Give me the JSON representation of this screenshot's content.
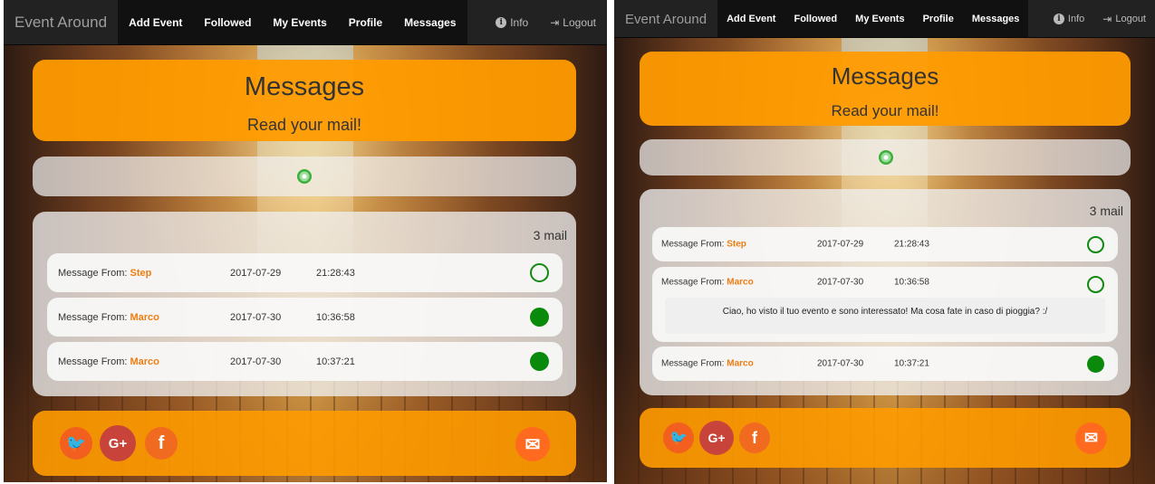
{
  "nav": {
    "brand": "Event Around",
    "links": [
      "Add Event",
      "Followed",
      "My Events",
      "Profile",
      "Messages"
    ],
    "info": "Info",
    "logout": "Logout"
  },
  "header": {
    "title": "Messages",
    "subtitle": "Read your mail!"
  },
  "inbox": {
    "count_label": "3 mail",
    "messages": [
      {
        "prefix": "Message From:",
        "sender": "Step",
        "date": "2017-07-29",
        "time": "21:28:43",
        "status": "unread"
      },
      {
        "prefix": "Message From:",
        "sender": "Marco",
        "date": "2017-07-30",
        "time": "10:36:58",
        "status": "read"
      },
      {
        "prefix": "Message From:",
        "sender": "Marco",
        "date": "2017-07-30",
        "time": "10:37:21",
        "status": "read"
      }
    ],
    "expanded_body": "Ciao, ho visto il tuo evento e sono interessato! Ma cosa fate in caso di pioggia? :/"
  },
  "footer": {
    "twitter": "🐦",
    "googleplus": "G+",
    "facebook": "f",
    "mail": "✉"
  },
  "colors": {
    "accent": "#ff9b00",
    "sender": "#ee7d12",
    "read_dot": "#0a8a0a"
  }
}
